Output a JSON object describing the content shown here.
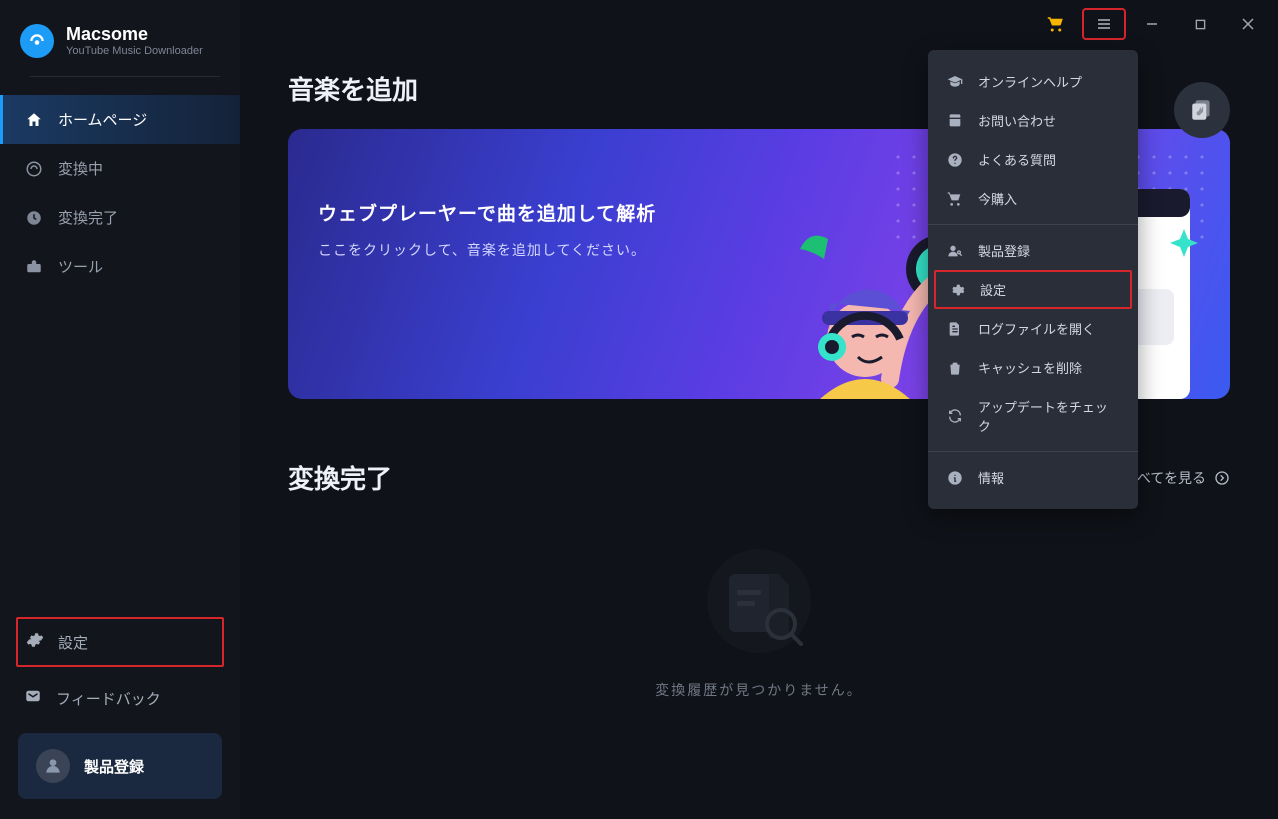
{
  "brand": {
    "name": "Macsome",
    "subtitle": "YouTube Music Downloader"
  },
  "sidebar": {
    "items": [
      {
        "label": "ホームページ"
      },
      {
        "label": "変換中"
      },
      {
        "label": "変換完了"
      },
      {
        "label": "ツール"
      }
    ],
    "settings_label": "設定",
    "feedback_label": "フィードバック",
    "register_label": "製品登録"
  },
  "main": {
    "add_title": "音楽を追加",
    "card_heading": "ウェブプレーヤーで曲を追加して解析",
    "card_sub": "ここをクリックして、音楽を追加してください。",
    "history_title": "変換完了",
    "view_all": "すべてを見る",
    "empty_text": "変換履歴が見つかりません。"
  },
  "menu": {
    "items": [
      {
        "label": "オンラインヘルプ",
        "icon": "graduation"
      },
      {
        "label": "お問い合わせ",
        "icon": "phone"
      },
      {
        "label": "よくある質問",
        "icon": "question"
      },
      {
        "label": "今購入",
        "icon": "cart"
      },
      {
        "label": "製品登録",
        "icon": "user-key"
      },
      {
        "label": "設定",
        "icon": "gear",
        "highlight": true
      },
      {
        "label": "ログファイルを開く",
        "icon": "file"
      },
      {
        "label": "キャッシュを削除",
        "icon": "trash"
      },
      {
        "label": "アップデートをチェック",
        "icon": "refresh"
      },
      {
        "label": "情報",
        "icon": "info"
      }
    ]
  }
}
